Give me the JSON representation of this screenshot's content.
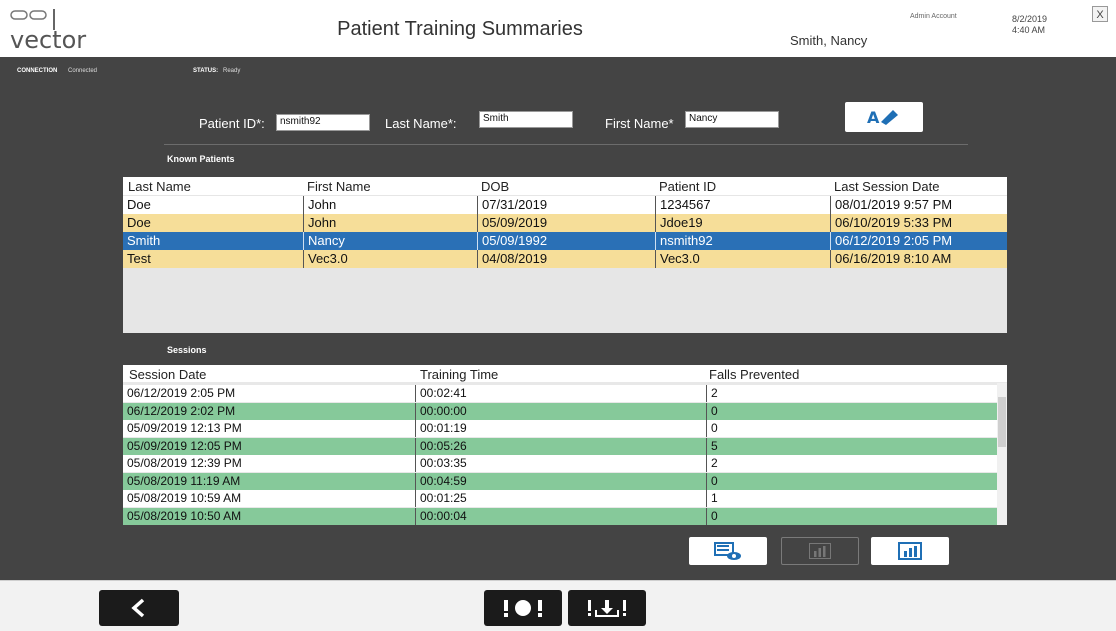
{
  "header": {
    "logo_text": "vector",
    "title": "Patient Training Summaries",
    "user_name": "Smith, Nancy",
    "account_type": "Admin Account",
    "date": "8/2/2019",
    "time": "4:40 AM",
    "close_label": "X"
  },
  "status": {
    "connection_label": "CONNECTION",
    "connection_value": "Connected",
    "status_label": "STATUS:",
    "status_value": "Ready"
  },
  "form": {
    "patient_id_label": "Patient ID*:",
    "patient_id_value": "nsmith92",
    "last_name_label": "Last Name*:",
    "last_name_value": "Smith",
    "first_name_label": "First Name*",
    "first_name_value": "Nancy"
  },
  "known_patients": {
    "title": "Known Patients",
    "columns": [
      "Last Name",
      "First Name",
      "DOB",
      "Patient ID",
      "Last Session Date"
    ],
    "rows": [
      {
        "cells": [
          "Doe",
          "John",
          "07/31/2019",
          "1234567",
          "08/01/2019 9:57 PM"
        ],
        "style": "white"
      },
      {
        "cells": [
          "Doe",
          "John",
          "05/09/2019",
          "Jdoe19",
          "06/10/2019 5:33 PM"
        ],
        "style": "yellow"
      },
      {
        "cells": [
          "Smith",
          "Nancy",
          "05/09/1992",
          "nsmith92",
          "06/12/2019 2:05 PM"
        ],
        "style": "selected"
      },
      {
        "cells": [
          "Test",
          "Vec3.0",
          "04/08/2019",
          "Vec3.0",
          "06/16/2019 8:10 AM"
        ],
        "style": "yellow"
      }
    ]
  },
  "sessions": {
    "title": "Sessions",
    "columns": [
      "Session Date",
      "Training Time",
      "Falls Prevented"
    ],
    "rows": [
      {
        "cells": [
          "06/12/2019 2:05 PM",
          "00:02:41",
          "2"
        ],
        "style": "white"
      },
      {
        "cells": [
          "06/12/2019 2:02 PM",
          "00:00:00",
          "0"
        ],
        "style": "green"
      },
      {
        "cells": [
          "05/09/2019 12:13 PM",
          "00:01:19",
          "0"
        ],
        "style": "white"
      },
      {
        "cells": [
          "05/09/2019 12:05 PM",
          "00:05:26",
          "5"
        ],
        "style": "green"
      },
      {
        "cells": [
          "05/08/2019 12:39 PM",
          "00:03:35",
          "2"
        ],
        "style": "white"
      },
      {
        "cells": [
          "05/08/2019 11:19 AM",
          "00:04:59",
          "0"
        ],
        "style": "green"
      },
      {
        "cells": [
          "05/08/2019 10:59 AM",
          "00:01:25",
          "1"
        ],
        "style": "white"
      },
      {
        "cells": [
          "05/08/2019 10:50 AM",
          "00:00:04",
          "0"
        ],
        "style": "green"
      }
    ]
  },
  "colors": {
    "background_dark": "#444444",
    "row_yellow": "#f6de99",
    "row_selected": "#2a70b6",
    "row_green": "#86c99a",
    "accent_blue": "#1f6fb5"
  },
  "icons": {
    "edit": "edit-patient-icon",
    "view_sessions": "view-sessions-icon",
    "chart_disabled": "bar-chart-icon",
    "chart": "bar-chart-icon",
    "back": "chevron-left-icon",
    "alert": "alert-icon",
    "download": "download-icon"
  }
}
